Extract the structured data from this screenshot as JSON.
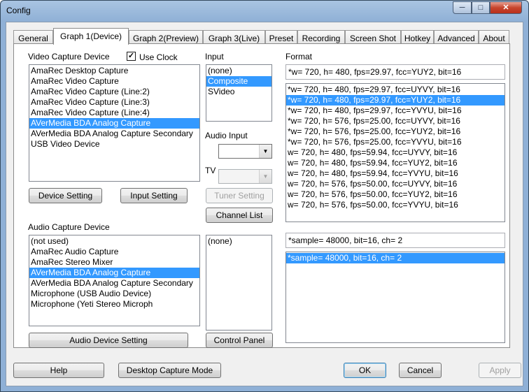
{
  "window": {
    "title": "Config",
    "min_glyph": "─",
    "max_glyph": "□",
    "close_glyph": "✕"
  },
  "tabs": [
    "General",
    "Graph 1(Device)",
    "Graph 2(Preview)",
    "Graph 3(Live)",
    "Preset",
    "Recording",
    "Screen Shot",
    "Hotkey",
    "Advanced",
    "About"
  ],
  "video": {
    "label": "Video Capture Device",
    "use_clock_label": "Use Clock",
    "use_clock_checked": true,
    "items": [
      "AmaRec Desktop Capture",
      "AmaRec Video Capture",
      "AmaRec Video Capture (Line:2)",
      "AmaRec Video Capture (Line:3)",
      "AmaRec Video Capture (Line:4)",
      "AVerMedia BDA Analog Capture",
      "AVerMedia BDA Analog Capture Secondary",
      "USB Video Device"
    ],
    "selected": 5,
    "device_setting": "Device Setting",
    "input_setting": "Input Setting"
  },
  "input": {
    "label": "Input",
    "items": [
      "(none)",
      "Composite",
      "SVideo"
    ],
    "selected": 1,
    "audio_input_label": "Audio Input",
    "tv_label": "TV",
    "tuner_setting": "Tuner Setting",
    "channel_list": "Channel List"
  },
  "format": {
    "label": "Format",
    "current": "*w= 720, h= 480, fps=29.97,  fcc=YUY2, bit=16",
    "items": [
      "*w= 720, h= 480, fps=29.97,  fcc=UYVY, bit=16",
      "*w= 720, h= 480, fps=29.97,  fcc=YUY2, bit=16",
      "*w= 720, h= 480, fps=29.97,  fcc=YVYU, bit=16",
      "*w= 720, h= 576, fps=25.00,  fcc=UYVY, bit=16",
      "*w= 720, h= 576, fps=25.00,  fcc=YUY2, bit=16",
      "*w= 720, h= 576, fps=25.00,  fcc=YVYU, bit=16",
      "w= 720, h= 480, fps=59.94,  fcc=UYVY, bit=16",
      "w= 720, h= 480, fps=59.94,  fcc=YUY2, bit=16",
      "w= 720, h= 480, fps=59.94,  fcc=YVYU, bit=16",
      "w= 720, h= 576, fps=50.00,  fcc=UYVY, bit=16",
      "w= 720, h= 576, fps=50.00,  fcc=YUY2, bit=16",
      "w= 720, h= 576, fps=50.00,  fcc=YVYU, bit=16"
    ],
    "selected": 1
  },
  "audio": {
    "label": "Audio Capture Device",
    "items": [
      "(not used)",
      "AmaRec Audio Capture",
      "AmaRec Stereo Mixer",
      "AVerMedia BDA Analog Capture",
      "AVerMedia BDA Analog Capture Secondary",
      "Microphone (USB Audio Device)",
      "Microphone (Yeti Stereo Microph"
    ],
    "selected": 3,
    "input_items": [
      "(none)"
    ],
    "device_setting": "Audio Device Setting",
    "control_panel": "Control Panel",
    "format_current": "*sample= 48000, bit=16, ch= 2",
    "format_items": [
      "*sample= 48000, bit=16, ch= 2"
    ],
    "format_selected": 0
  },
  "footer": {
    "help": "Help",
    "desktop_capture_mode": "Desktop Capture Mode",
    "ok": "OK",
    "cancel": "Cancel",
    "apply": "Apply"
  }
}
